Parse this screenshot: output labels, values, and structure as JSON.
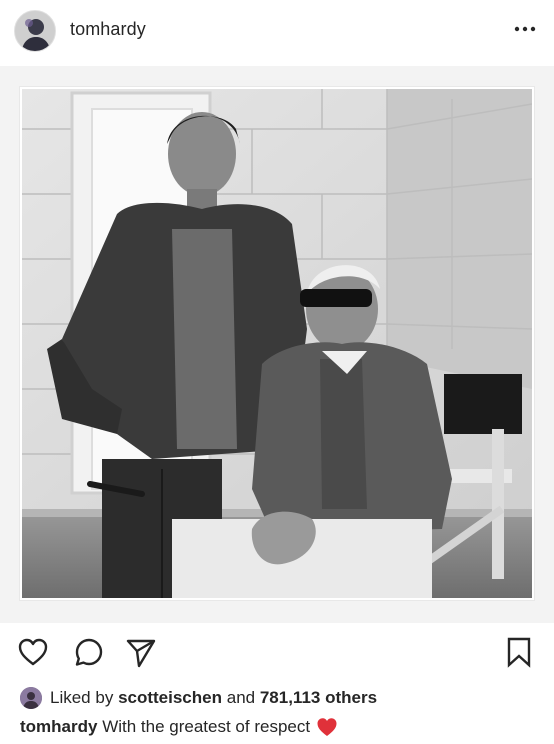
{
  "post": {
    "username": "tomhardy",
    "more_icon": "more-horizontal-icon",
    "photo_description_icon": "photo"
  },
  "actions": {
    "like_icon": "heart-icon",
    "comment_icon": "comment-icon",
    "share_icon": "send-icon",
    "save_icon": "bookmark-icon"
  },
  "likes": {
    "prefix": "Liked by",
    "user": "scotteischen",
    "middle": "and",
    "count": "781,113 others"
  },
  "caption": {
    "username": "tomhardy",
    "text": "With the greatest of respect",
    "emoji": "red-heart"
  },
  "colors": {
    "text": "#262626",
    "heart_emoji": "#e0313a",
    "background": "#ffffff",
    "post_area": "#f3f3f3"
  }
}
